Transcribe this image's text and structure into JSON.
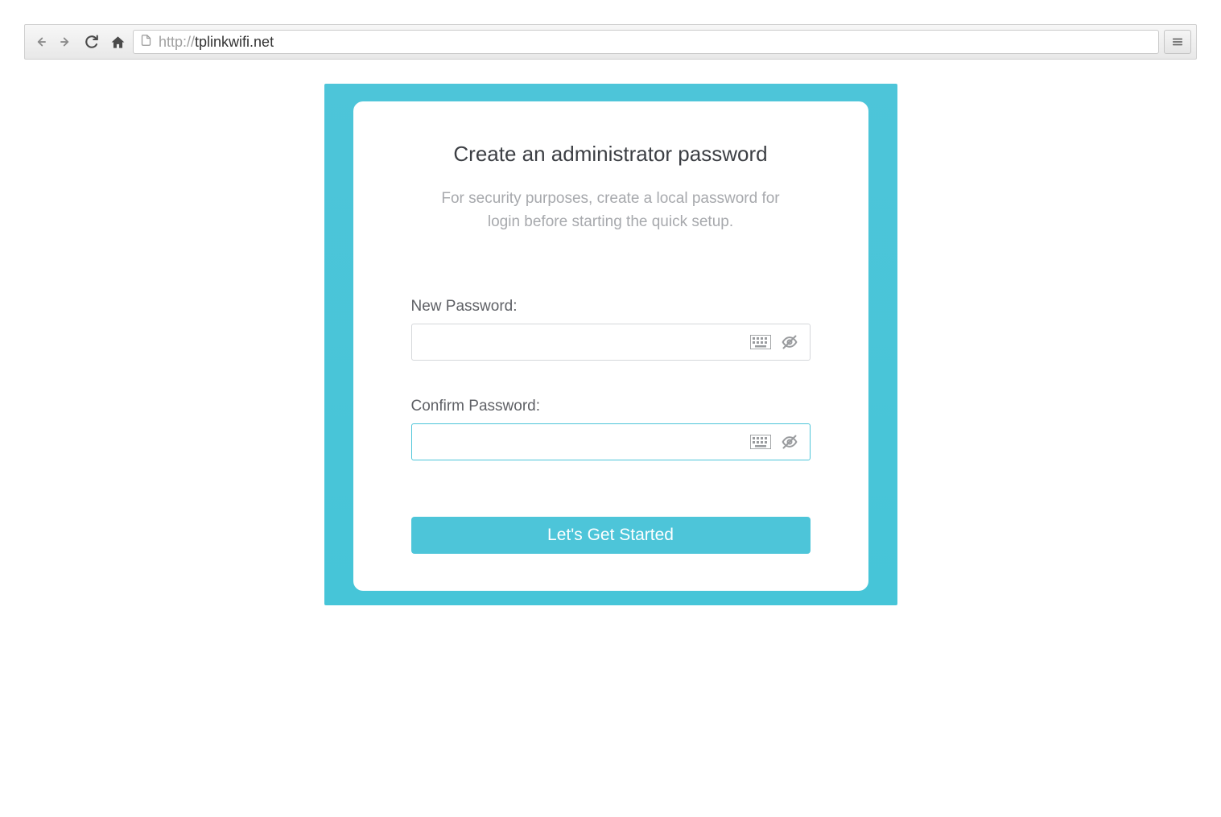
{
  "browser": {
    "url_prefix": "http://",
    "url_host": "tplinkwifi.net"
  },
  "page": {
    "title": "Create an administrator password",
    "subtitle": "For security purposes, create a local password for login before starting the quick setup.",
    "new_password_label": "New Password:",
    "confirm_password_label": "Confirm Password:",
    "submit_label": "Let's Get Started"
  }
}
